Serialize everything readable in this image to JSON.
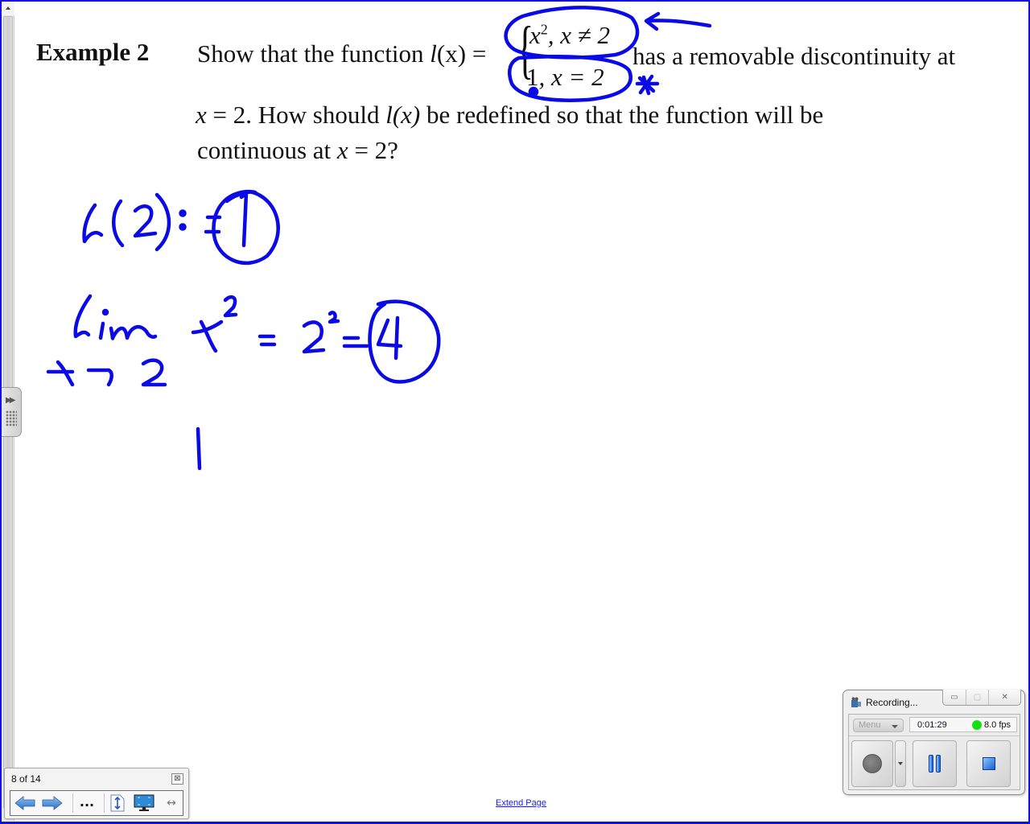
{
  "document": {
    "example_label": "Example 2",
    "line1_prefix": "Show that the function ",
    "func_name": "l",
    "func_arg": "(x) =",
    "cases": [
      {
        "expr": "x",
        "exp": "2",
        "cond": ", x ≠ 2"
      },
      {
        "expr": "1",
        "exp": "",
        "cond": ", x = 2"
      }
    ],
    "line1_suffix": "has a removable discontinuity at",
    "line2_var": "x",
    "line2_a": " = 2.  How should ",
    "line2_func": "l",
    "line2_b": "(x)",
    "line2_c": " be redefined so that the function will be",
    "line3_a": "continuous at ",
    "line3_var": "x",
    "line3_b": " = 2?"
  },
  "handwriting": {
    "ink_color": "#0a0ae6",
    "line1": "l(2) := 1 (circled)",
    "line2": "lim x→2 x² = 2² = 4 (circled)",
    "line3": "|"
  },
  "extend_page_label": "Extend Page",
  "pager": {
    "page_count": "8 of 14",
    "close_label": "⊠",
    "buttons": [
      "back-arrow",
      "forward-arrow",
      "more-options",
      "page-height",
      "full-screen",
      "page-width"
    ],
    "more_label": "..."
  },
  "recorder": {
    "title": "Recording...",
    "menu_label": "Menu",
    "elapsed": "0:01:29",
    "fps": "8.0 fps",
    "status_color": "#14e014",
    "min_label": "▭",
    "restore_label": "▢",
    "close_label": "✕"
  }
}
